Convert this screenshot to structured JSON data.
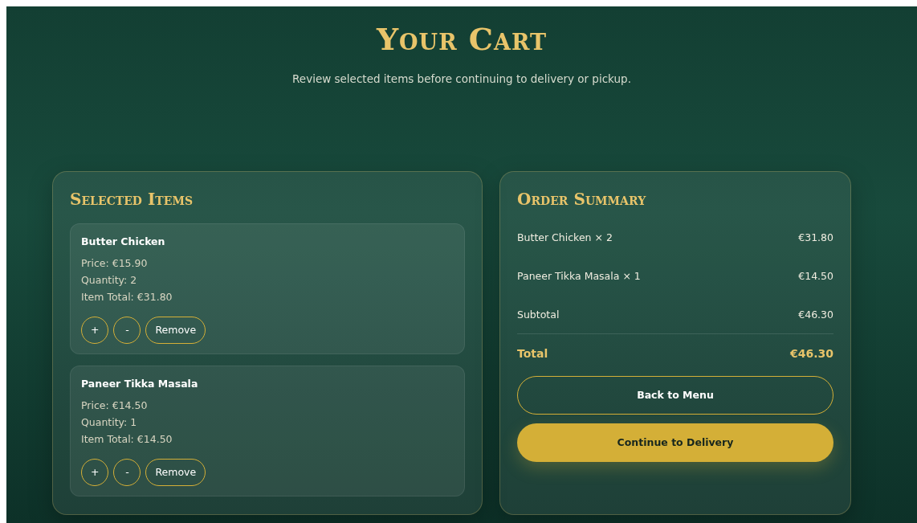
{
  "header": {
    "title": "Your Cart",
    "subtitle": "Review selected items before continuing to delivery or pickup."
  },
  "selected_items": {
    "title": "Selected Items",
    "items": [
      {
        "name": "Butter Chicken",
        "price": "Price: €15.90",
        "quantity": "Quantity: 2",
        "item_total": "Item Total: €31.80",
        "buttons": [
          "+",
          "-",
          "Remove"
        ]
      },
      {
        "name": "Paneer Tikka Masala",
        "price": "Price: €14.50",
        "quantity": "Quantity: 1",
        "item_total": "Item Total: €14.50",
        "buttons": [
          "+",
          "-",
          "Remove"
        ]
      }
    ]
  },
  "order_summary": {
    "title": "Order Summary",
    "lines": [
      {
        "kind": "item",
        "label": "Butter Chicken × 2",
        "value": "€31.80"
      },
      {
        "kind": "item",
        "label": "Paneer Tikka Masala × 1",
        "value": "€14.50"
      },
      {
        "kind": "subtotal",
        "label": "Subtotal",
        "value": "€46.30"
      },
      {
        "kind": "total",
        "label": "Total",
        "value": "€46.30"
      }
    ],
    "buttons": [
      {
        "kind": "secondary",
        "label": "Back to Menu"
      },
      {
        "kind": "primary",
        "label": "Continue to Delivery"
      }
    ]
  }
}
